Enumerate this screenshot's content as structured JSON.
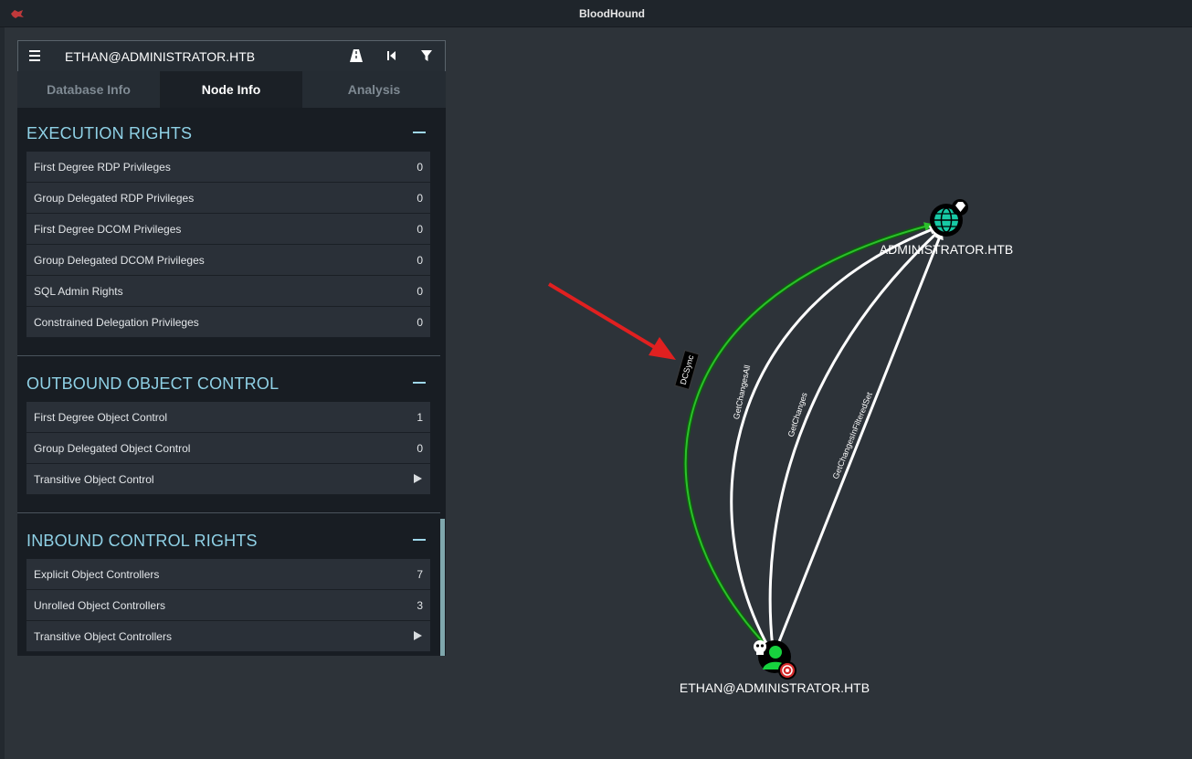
{
  "window": {
    "title": "BloodHound"
  },
  "search": {
    "value": "ETHAN@ADMINISTRATOR.HTB"
  },
  "tabs": [
    {
      "label": "Database Info"
    },
    {
      "label": "Node Info"
    },
    {
      "label": "Analysis"
    }
  ],
  "sections": {
    "execution": {
      "title": "EXECUTION RIGHTS",
      "rows": [
        {
          "label": "First Degree RDP Privileges",
          "value": "0"
        },
        {
          "label": "Group Delegated RDP Privileges",
          "value": "0"
        },
        {
          "label": "First Degree DCOM Privileges",
          "value": "0"
        },
        {
          "label": "Group Delegated DCOM Privileges",
          "value": "0"
        },
        {
          "label": "SQL Admin Rights",
          "value": "0"
        },
        {
          "label": "Constrained Delegation Privileges",
          "value": "0"
        }
      ]
    },
    "outbound": {
      "title": "OUTBOUND OBJECT CONTROL",
      "rows": [
        {
          "label": "First Degree Object Control",
          "value": "1"
        },
        {
          "label": "Group Delegated Object Control",
          "value": "0"
        },
        {
          "label": "Transitive Object Control",
          "value": ""
        }
      ]
    },
    "inbound": {
      "title": "INBOUND CONTROL RIGHTS",
      "rows": [
        {
          "label": "Explicit Object Controllers",
          "value": "7"
        },
        {
          "label": "Unrolled Object Controllers",
          "value": "3"
        },
        {
          "label": "Transitive Object Controllers",
          "value": ""
        }
      ]
    }
  },
  "graph": {
    "nodes": {
      "domain": {
        "label": "ADMINISTRATOR.HTB"
      },
      "user": {
        "label": "ETHAN@ADMINISTRATOR.HTB"
      }
    },
    "edges": {
      "dcsync": "DCSync",
      "getchangesall": "GetChangesAll",
      "getchanges": "GetChanges",
      "getchangesinfilteredset": "GetChangesInFilteredSet"
    }
  },
  "colors": {
    "accent": "#8fd1e6",
    "edge_highlight": "#1e9e1e",
    "annotation_arrow": "#e02020"
  }
}
